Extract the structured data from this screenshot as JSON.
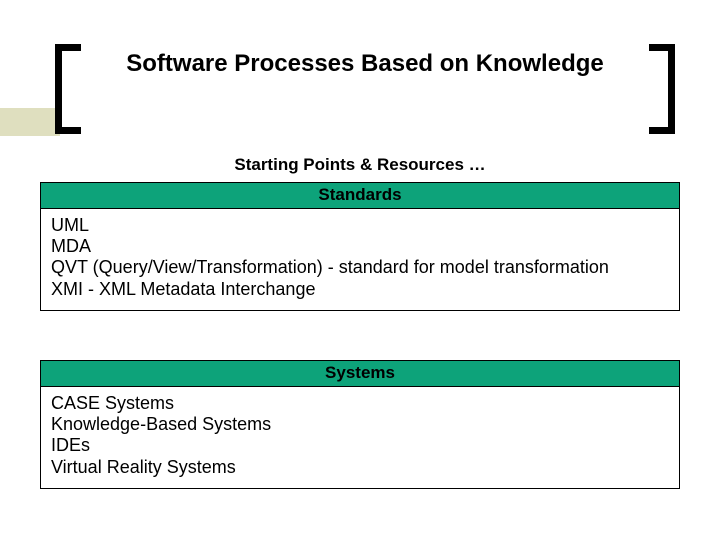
{
  "title": "Software Processes Based on Knowledge",
  "subtitle": "Starting Points & Resources …",
  "sections": {
    "standards": {
      "header": "Standards",
      "items": [
        "UML",
        "MDA",
        "QVT (Query/View/Transformation) - standard for model transformation",
        "XMI - XML Metadata Interchange"
      ]
    },
    "systems": {
      "header": "Systems",
      "items": [
        "CASE Systems",
        "Knowledge-Based Systems",
        "IDEs",
        "Virtual Reality Systems"
      ]
    }
  }
}
